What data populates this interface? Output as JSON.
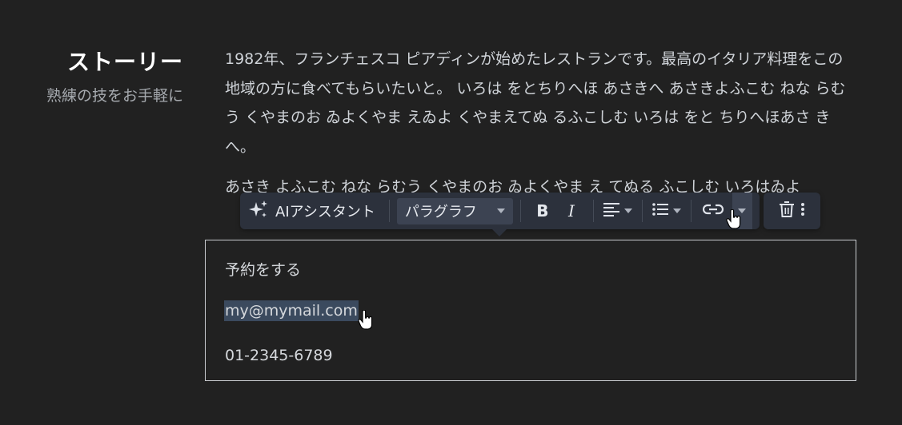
{
  "section": {
    "title": "ストーリー",
    "subtitle": "熟練の技をお手軽に"
  },
  "story": {
    "paragraph1": "1982年、フランチェスコ ピアディンが始めたレストランです。最高のイタリア料理をこの地域の方に食べてもらいたいと。 いろは をとちりへほ あさきへ あさきよふこむ ねな らむう くやまのお ゐよくやま えゐよ くやまえてぬ るふこしむ いろは をと ちりへほあさ きへ。",
    "paragraph2": "あさき よふこむ ねな らむう くやまのお ゐよくやま え てぬる ふこしむ いろはゐよ"
  },
  "toolbar": {
    "ai_label": "AIアシスタント",
    "paragraph_label": "パラグラフ",
    "bold_label": "B",
    "italic_label": "I",
    "icons": [
      "sparkle-icon",
      "align-left-icon",
      "bulleted-list-icon",
      "link-icon",
      "trash-icon",
      "more-vertical-icon"
    ]
  },
  "contact": {
    "heading": "予約をする",
    "email": "my@mymail.com",
    "phone": "01-2345-6789"
  },
  "colors": {
    "background": "#212121",
    "toolbar": "#2c313c",
    "selection": "#3b4a5e"
  }
}
